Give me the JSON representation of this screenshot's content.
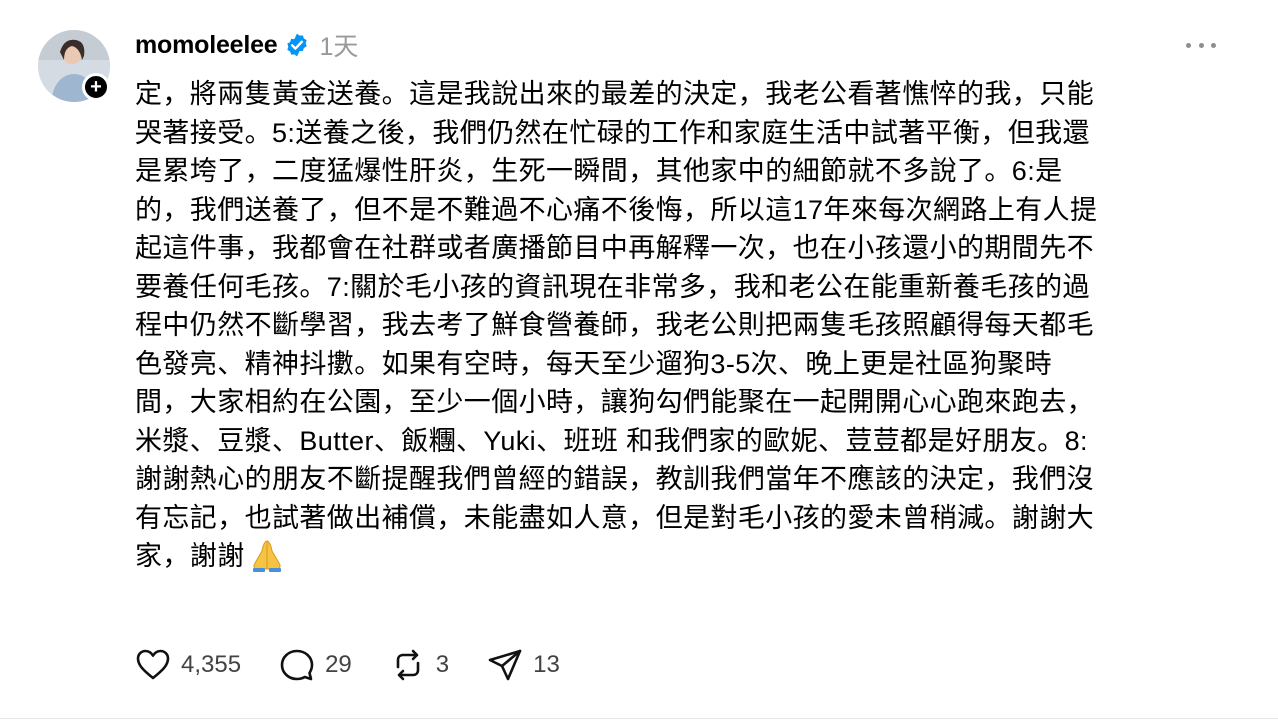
{
  "post": {
    "username": "momoleelee",
    "timestamp": "1天",
    "follow_symbol": "+",
    "body_lines": [
      "定，將兩隻黃金送養。這是我說出來的最差的決定，我老公看著憔悴的我，只能",
      "哭著接受。5:送養之後，我們仍然在忙碌的工作和家庭生活中試著平衡，但我還",
      "是累垮了，二度猛爆性肝炎，生死一瞬間，其他家中的細節就不多說了。6:是",
      "的，我們送養了，但不是不難過不心痛不後悔，所以這17年來每次網路上有人提",
      "起這件事，我都會在社群或者廣播節目中再解釋一次，也在小孩還小的期間先不",
      "要養任何毛孩。7:關於毛小孩的資訊現在非常多，我和老公在能重新養毛孩的過",
      "程中仍然不斷學習，我去考了鮮食營養師，我老公則把兩隻毛孩照顧得每天都毛",
      "色發亮、精神抖擻。如果有空時，每天至少遛狗3-5次、晚上更是社區狗聚時",
      "間，大家相約在公園，至少一個小時，讓狗勾們能聚在一起開開心心跑來跑去，",
      "米漿、豆漿、Butter、飯糰、Yuki、班班 和我們家的歐妮、荳荳都是好朋友。8:",
      "謝謝熱心的朋友不斷提醒我們曾經的錯誤，教訓我們當年不應該的決定，我們沒",
      "有忘記，也試著做出補償，未能盡如人意，但是對毛小孩的愛未曾稍減。謝謝大",
      "家，謝謝"
    ],
    "emoji_icon": "folded-hands-icon",
    "actions": {
      "likes": "4,355",
      "comments": "29",
      "reposts": "3",
      "shares": "13"
    }
  },
  "colors": {
    "text": "#000000",
    "muted": "#999999",
    "verified_blue": "#0095f6",
    "count_text": "#424242"
  }
}
